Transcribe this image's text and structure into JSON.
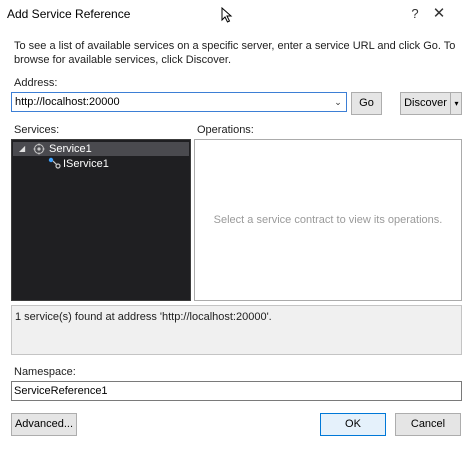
{
  "window": {
    "title": "Add Service Reference",
    "help_glyph": "?",
    "close_glyph": "✕"
  },
  "instructions": "To see a list of available services on a specific server, enter a service URL and click Go. To browse for available services, click Discover.",
  "address": {
    "label": "Address:",
    "value": "http://localhost:20000",
    "dropdown_glyph": "⌄"
  },
  "buttons": {
    "go": "Go",
    "discover": "Discover",
    "discover_split_glyph": "▾",
    "advanced": "Advanced...",
    "ok": "OK",
    "cancel": "Cancel"
  },
  "services": {
    "label": "Services:",
    "tree": [
      {
        "label": "Service1",
        "icon": "service-icon",
        "expanded": true,
        "selected": true
      },
      {
        "label": "IService1",
        "icon": "interface-icon",
        "expanded": false,
        "selected": false
      }
    ],
    "caret_glyph": "◢"
  },
  "operations": {
    "label": "Operations:",
    "placeholder": "Select a service contract to view its operations."
  },
  "status": "1 service(s) found at address 'http://localhost:20000'.",
  "namespace": {
    "label": "Namespace:",
    "value": "ServiceReference1"
  },
  "colors": {
    "accent": "#0078d7",
    "tree_background": "#1f1f22",
    "tree_selected": "#4a4a4f"
  }
}
